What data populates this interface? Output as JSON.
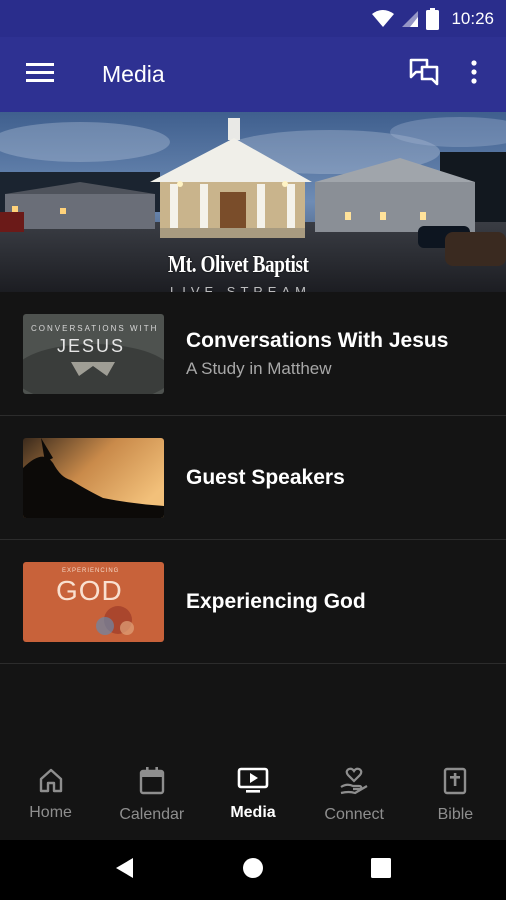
{
  "status_bar": {
    "time": "10:26"
  },
  "app_bar": {
    "title": "Media"
  },
  "hero": {
    "church_name": "Mt. Olivet Baptist",
    "subtitle": "LIVE STREAM"
  },
  "media_items": [
    {
      "title": "Conversations With Jesus",
      "subtitle": "A Study in Matthew",
      "thumb_line1": "CONVERSATIONS WITH",
      "thumb_line2": "JESUS"
    },
    {
      "title": "Guest Speakers",
      "subtitle": ""
    },
    {
      "title": "Experiencing God",
      "subtitle": "",
      "thumb_line1": "EXPERIENCING",
      "thumb_line2": "GOD"
    }
  ],
  "bottom_nav": [
    {
      "label": "Home",
      "icon": "home-icon",
      "active": false
    },
    {
      "label": "Calendar",
      "icon": "calendar-icon",
      "active": false
    },
    {
      "label": "Media",
      "icon": "tv-play-icon",
      "active": true
    },
    {
      "label": "Connect",
      "icon": "hand-heart-icon",
      "active": false
    },
    {
      "label": "Bible",
      "icon": "bible-icon",
      "active": false
    }
  ],
  "colors": {
    "app_bar": "#2e3192",
    "status_bar": "#2a2d8c",
    "background": "#141414",
    "active_nav": "#ffffff",
    "inactive_nav": "#8e8e8e"
  }
}
